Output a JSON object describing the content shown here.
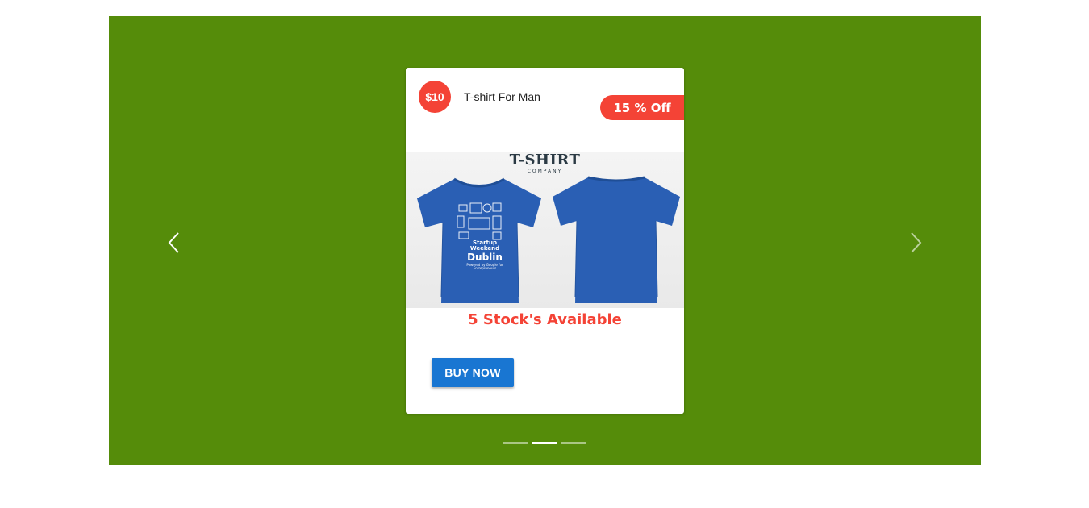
{
  "carousel": {
    "background_color": "#558c0a",
    "prev_icon": "chevron-left-icon",
    "next_icon": "chevron-right-icon",
    "active_slide": 2,
    "slide_count": 3
  },
  "card": {
    "price": "$10",
    "title": "T-shirt For Man",
    "discount": "15 % Off",
    "image": {
      "brand": "T-SHIRT",
      "brand_sub": "COMPANY",
      "print_line1": "Startup Weekend",
      "print_line2": "Dublin",
      "print_line3": "Powered by Google for Entrepreneurs"
    },
    "stock": "5 Stock's Available",
    "buy_label": "BUY NOW"
  },
  "colors": {
    "accent_red": "#f44336",
    "button_blue": "#1976d2",
    "shirt_blue": "#2a5fb4"
  }
}
